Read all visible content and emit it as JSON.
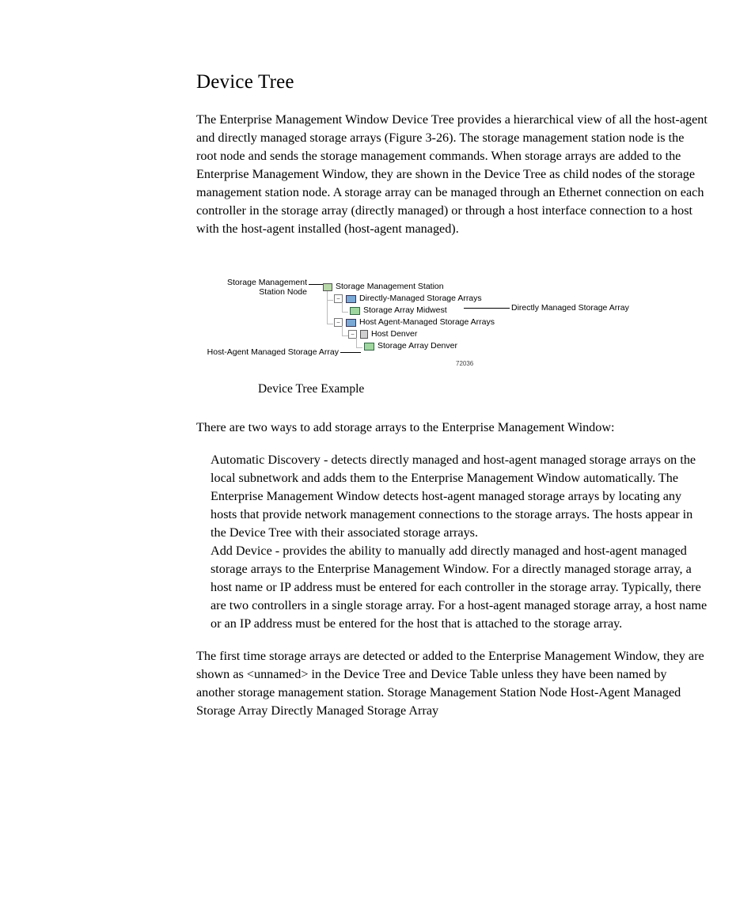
{
  "title": "Device Tree",
  "para1": "The Enterprise Management Window Device Tree provides a hierarchical view of all the host-agent and directly managed storage arrays (Figure 3-26). The storage management station node is the root node and sends the storage management commands. When storage arrays are added to the Enterprise Management Window, they are shown in the Device Tree as child nodes of the storage management station node. A storage array can be managed through an Ethernet connection on each controller in the storage array (directly managed) or through a host interface connection to a host with the host-agent installed (host-agent managed).",
  "figure": {
    "callouts": {
      "root_label": "Storage Management\nStation Node",
      "direct_label": "Directly Managed Storage Array",
      "hostagent_label": "Host-Agent Managed Storage Array"
    },
    "tree": {
      "root": "Storage Management Station",
      "direct_group": "Directly-Managed Storage Arrays",
      "direct_item": "Storage Array Midwest",
      "hostagent_group": "Host Agent-Managed Storage Arrays",
      "host_item": "Host Denver",
      "hostagent_array": "Storage Array Denver"
    },
    "figure_id": "72036",
    "caption": "Device Tree Example"
  },
  "para2": "There are two ways to add storage arrays to the Enterprise Management Window:",
  "list": {
    "item1": "Automatic Discovery - detects directly managed and host-agent managed storage arrays on the local subnetwork and adds them to the Enterprise Management Window automatically. The Enterprise Management Window detects host-agent managed storage arrays by locating any hosts that provide network management connections to the storage arrays. The hosts appear in the Device Tree with their associated storage arrays.",
    "item2": "Add Device - provides the ability to manually add directly managed and host-agent managed storage arrays to the Enterprise Management Window. For a directly managed storage array, a host name or IP address must be entered for each controller in the storage array. Typically, there are two controllers in a single storage array. For a host-agent managed storage array, a host name or an IP address must be entered for the host that is attached to the storage array."
  },
  "para3": "The first time storage arrays are detected or added to the Enterprise Management Window, they are shown as <unnamed> in the Device Tree and Device Table unless they have been named by another storage management station. Storage Management Station Node Host-Agent Managed Storage Array Directly Managed Storage Array"
}
